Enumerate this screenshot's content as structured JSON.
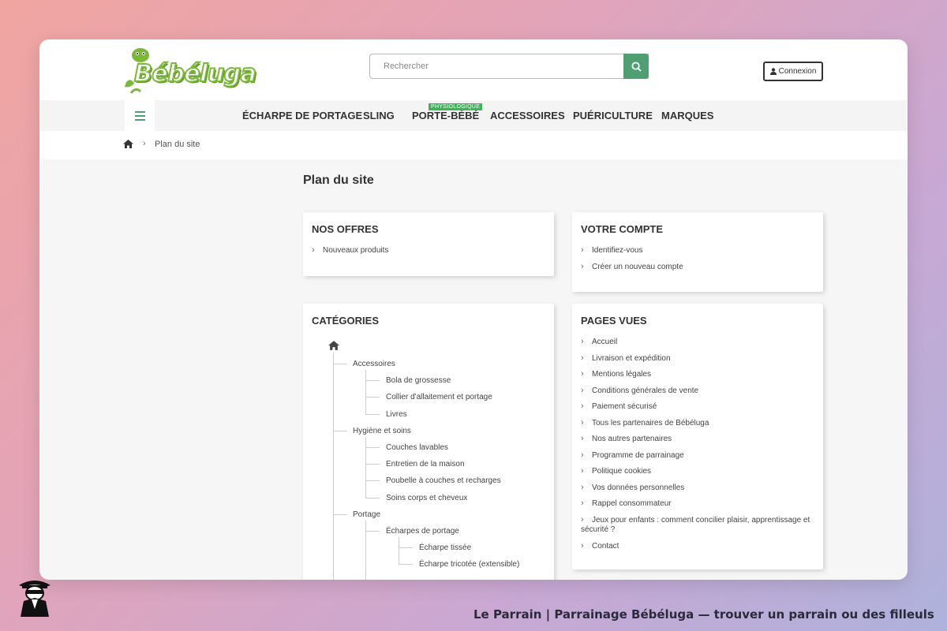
{
  "header": {
    "logo_text": "Bébéluga",
    "search_placeholder": "Rechercher",
    "login_label": "Connexion"
  },
  "nav": {
    "items": [
      "ÉCHARPE DE PORTAGE",
      "SLING",
      "PORTE-BÉBÉ",
      "ACCESSOIRES",
      "PUÉRICULTURE",
      "MARQUES"
    ],
    "badge": "PHYSIOLOGIQUE"
  },
  "breadcrumb": {
    "current": "Plan du site"
  },
  "page": {
    "title": "Plan du site"
  },
  "offers": {
    "title": "NOS OFFRES",
    "links": [
      "Nouveaux produits"
    ]
  },
  "account": {
    "title": "VOTRE COMPTE",
    "links": [
      "Identifiez-vous",
      "Créer un nouveau compte"
    ]
  },
  "categories": {
    "title": "CATÉGORIES",
    "items": [
      "Accessoires",
      "Bola de grossesse",
      "Collier d'allaitement et portage",
      "Livres",
      "Hygiène et soins",
      "Couches lavables",
      "Entretien de la maison",
      "Poubelle à couches et recharges",
      "Soins corps et cheveux",
      "Portage",
      "Écharpes de portage",
      "Écharpe tissée",
      "Écharpe tricotée (extensible)"
    ]
  },
  "pages": {
    "title": "PAGES VUES",
    "links": [
      "Accueil",
      "Livraison et expédition",
      "Mentions légales",
      "Conditions générales de vente",
      "Paiement sécurisé",
      "Tous les partenaires de Bébéluga",
      "Nos autres partenaires",
      "Programme de parrainage",
      "Politique cookies",
      "Vos données personnelles",
      "Rappel consommateur",
      "Jeux pour enfants : comment concilier plaisir, apprentissage et sécurité ?",
      "Contact"
    ]
  },
  "footer": {
    "caption": "Le Parrain | Parrainage Bébéluga — trouver un parrain ou des filleuls"
  },
  "colors": {
    "brand_green": "#4f9f72",
    "badge_green": "#3cb45a",
    "logo_green": "#7bb83a"
  }
}
